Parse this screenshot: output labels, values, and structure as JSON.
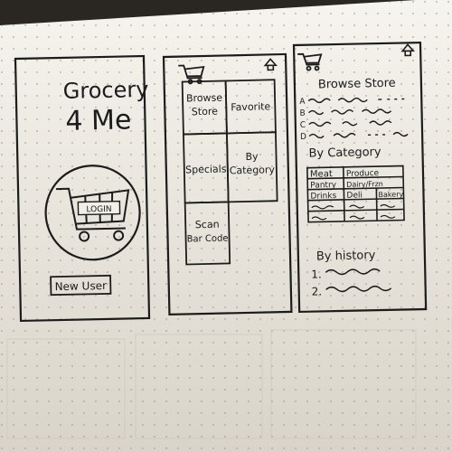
{
  "screen_login": {
    "title_line1": "Grocery",
    "title_line2": "4 Me",
    "cart_label": "LOGIN",
    "new_user": "New User"
  },
  "screen_menu": {
    "tiles": [
      {
        "line1": "Browse",
        "line2": "Store"
      },
      {
        "line1": "Favorite",
        "line2": ""
      },
      {
        "line1": "Specials",
        "line2": ""
      },
      {
        "line1": "By",
        "line2": "Category"
      },
      {
        "line1": "Scan",
        "line2": "Bar Code"
      }
    ]
  },
  "screen_browse": {
    "browse_heading": "Browse Store",
    "browse_letters": [
      "A",
      "B",
      "C",
      "D"
    ],
    "category_heading": "By Category",
    "category_grid": [
      [
        "Meat",
        "Produce"
      ],
      [
        "Pantry",
        "Dairy/Frzn"
      ],
      [
        "Drinks",
        "Deli",
        "Bakery"
      ]
    ],
    "history_heading": "By history",
    "history_items": [
      "1.",
      "2."
    ]
  },
  "colors": {
    "paper": "#f1efe8",
    "ink": "#1c1c1c",
    "background": "#2a2622"
  }
}
